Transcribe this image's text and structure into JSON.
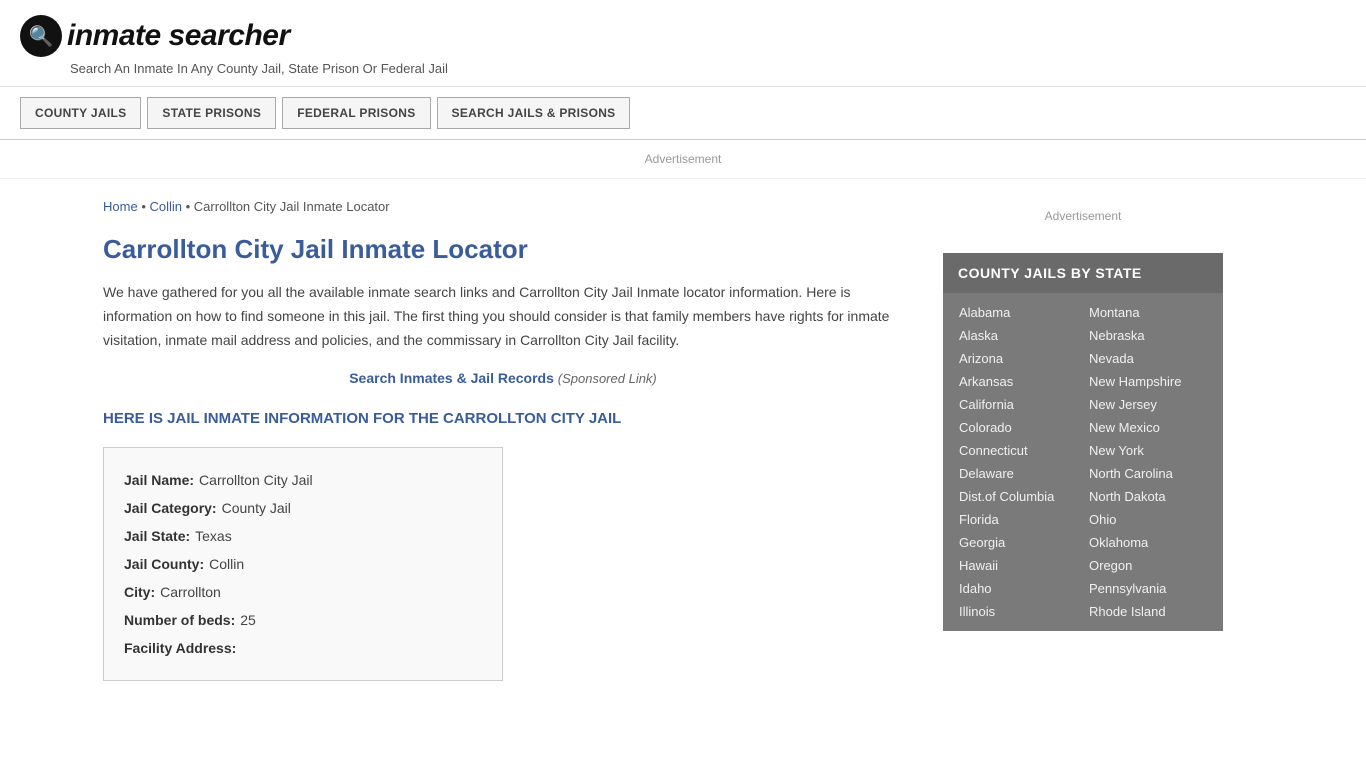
{
  "header": {
    "logo_icon": "🔍",
    "logo_text": "inmate searcher",
    "tagline": "Search An Inmate In Any County Jail, State Prison Or Federal Jail"
  },
  "nav": {
    "buttons": [
      {
        "label": "COUNTY JAILS"
      },
      {
        "label": "STATE PRISONS"
      },
      {
        "label": "FEDERAL PRISONS"
      },
      {
        "label": "SEARCH JAILS & PRISONS"
      }
    ]
  },
  "ad_label": "Advertisement",
  "breadcrumb": {
    "home": "Home",
    "separator1": " • ",
    "collin": "Collin",
    "separator2": " • ",
    "current": "Carrollton City Jail Inmate Locator"
  },
  "page_title": "Carrollton City Jail Inmate Locator",
  "description": "We have gathered for you all the available inmate search links and Carrollton City Jail Inmate locator information. Here is information on how to find someone in this jail. The first thing you should consider is that family members have rights for inmate visitation, inmate mail address and policies, and the commissary in Carrollton City Jail facility.",
  "sponsored": {
    "link_text": "Search Inmates & Jail Records",
    "tag": "(Sponsored Link)"
  },
  "section_heading": "HERE IS JAIL INMATE INFORMATION FOR THE CARROLLTON CITY JAIL",
  "info": {
    "jail_name_label": "Jail Name:",
    "jail_name_value": "Carrollton City Jail",
    "jail_category_label": "Jail Category:",
    "jail_category_value": "County Jail",
    "jail_state_label": "Jail State:",
    "jail_state_value": "Texas",
    "jail_county_label": "Jail County:",
    "jail_county_value": "Collin",
    "city_label": "City:",
    "city_value": "Carrollton",
    "beds_label": "Number of beds:",
    "beds_value": "25",
    "facility_address_label": "Facility Address:"
  },
  "sidebar": {
    "ad_label": "Advertisement",
    "widget_header": "COUNTY JAILS BY STATE",
    "states_left": [
      "Alabama",
      "Alaska",
      "Arizona",
      "Arkansas",
      "California",
      "Colorado",
      "Connecticut",
      "Delaware",
      "Dist.of Columbia",
      "Florida",
      "Georgia",
      "Hawaii",
      "Idaho",
      "Illinois"
    ],
    "states_right": [
      "Montana",
      "Nebraska",
      "Nevada",
      "New Hampshire",
      "New Jersey",
      "New Mexico",
      "New York",
      "North Carolina",
      "North Dakota",
      "Ohio",
      "Oklahoma",
      "Oregon",
      "Pennsylvania",
      "Rhode Island"
    ]
  }
}
